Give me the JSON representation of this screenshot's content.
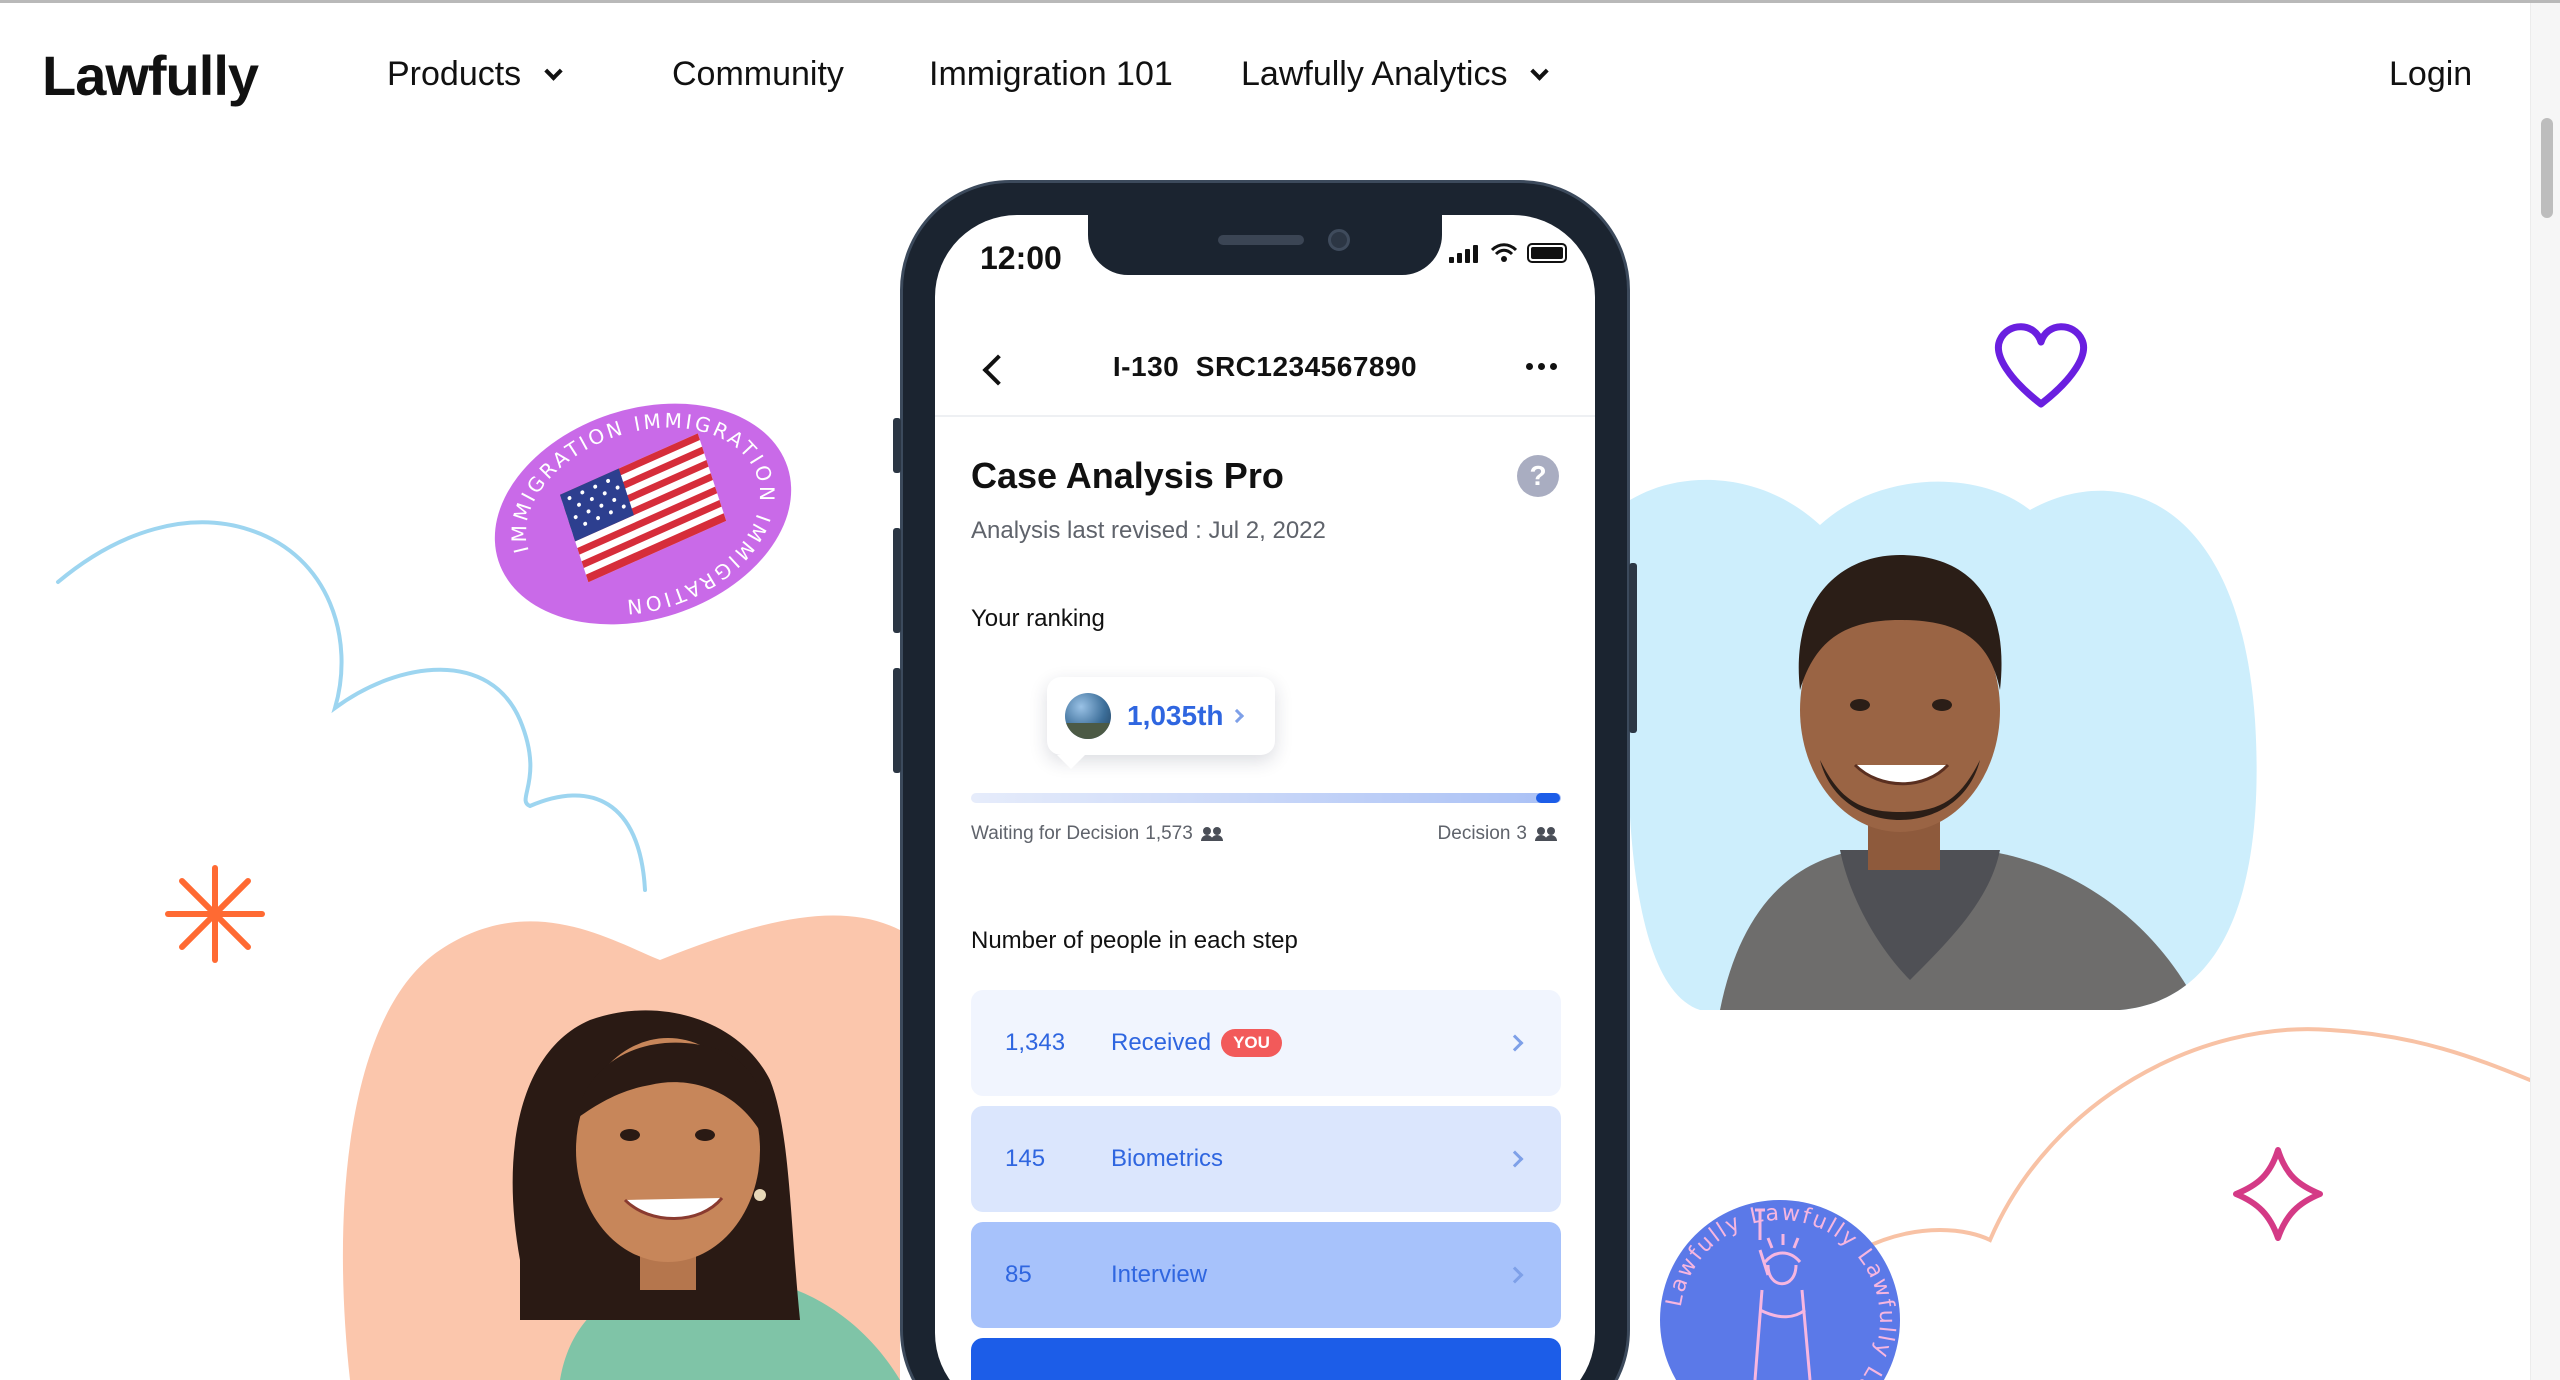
{
  "nav": {
    "logo": "Lawfully",
    "items": [
      {
        "label": "Products",
        "has_dropdown": true
      },
      {
        "label": "Community",
        "has_dropdown": false
      },
      {
        "label": "Immigration 101",
        "has_dropdown": false
      },
      {
        "label": "Lawfully Analytics",
        "has_dropdown": true
      }
    ],
    "login": "Login"
  },
  "phone": {
    "status_time": "12:00",
    "header_title": "I-130  SRC1234567890",
    "card_title": "Case Analysis Pro",
    "revised_label": "Analysis last revised :",
    "revised_date": "Jul 2, 2022",
    "help": "?",
    "ranking_label": "Your ranking",
    "ranking_value": "1,035th",
    "progress": {
      "fraction": 0.998,
      "left_label": "Waiting for Decision",
      "left_count": "1,573",
      "right_label": "Decision",
      "right_count": "3"
    },
    "steps_label": "Number of people in each step",
    "steps": [
      {
        "count": "1,343",
        "name": "Received",
        "badge": "YOU",
        "bg": "#f1f5fe"
      },
      {
        "count": "145",
        "name": "Biometrics",
        "badge": "",
        "bg": "#dbe6fd"
      },
      {
        "count": "85",
        "name": "Interview",
        "badge": "",
        "bg": "#a7c2fb"
      },
      {
        "count": "",
        "name": "",
        "badge": "",
        "bg": "#1c5de8"
      }
    ]
  },
  "stickers": {
    "immigration_text": "IMMIGRATION IMMIGRATION IMMIGRATION",
    "lawfully_text": "Lawfully Lawfully Lawfully Lawfully"
  },
  "colors": {
    "accent_blue": "#1c5de8",
    "link_blue": "#2f66e0",
    "sticker_pink": "#c96ae8",
    "sticker_blue": "#5b79e8",
    "heart_purple": "#6a1fe0",
    "star_pink": "#d43a86",
    "asterisk_orange": "#ff6a33",
    "blob_peach": "#fbc6ac",
    "blob_sky": "#cdeefc",
    "line_sky": "#9dd5f0",
    "line_peach": "#f8c2a5"
  },
  "icons": [
    "chevron-down-icon",
    "back-chevron-icon",
    "more-dots-icon",
    "help-icon",
    "people-icon",
    "heart-icon",
    "sparkle-icon",
    "asterisk-icon",
    "us-flag-icon",
    "statue-of-liberty-icon"
  ]
}
